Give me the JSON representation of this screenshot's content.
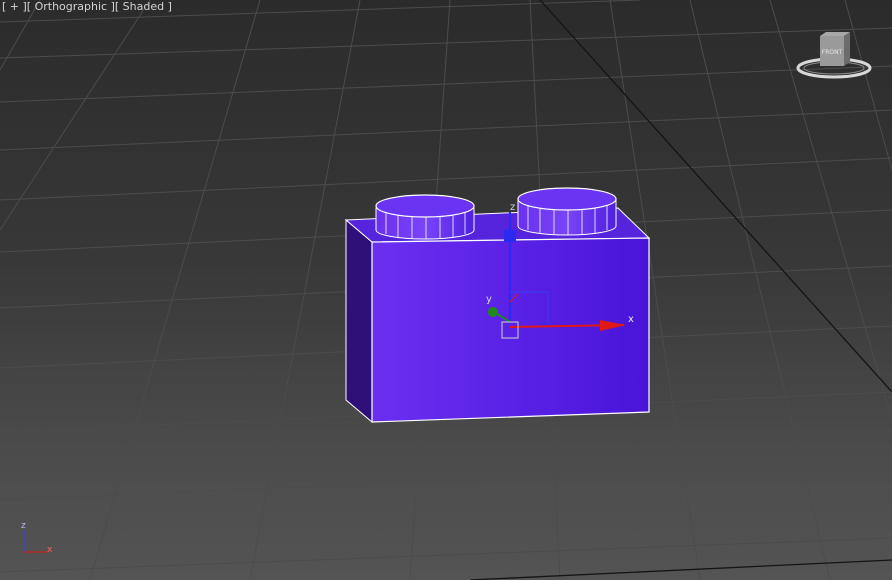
{
  "viewport": {
    "label": {
      "plus": "[ + ]",
      "view": "[ Orthographic ]",
      "shading": "[ Shaded ]"
    },
    "viewcube": {
      "face_label": "FRONT"
    },
    "gizmo": {
      "x_label": "x",
      "y_label": "y",
      "z_label": "z"
    },
    "corner_axis": {
      "z_label": "z",
      "x_label": "x"
    },
    "colors": {
      "brick": "#5a22e0",
      "brick_side": "#2f0f78",
      "gizmo_x": "#e01818",
      "gizmo_y": "#1e8a1e",
      "gizmo_z": "#2a2af0"
    }
  }
}
